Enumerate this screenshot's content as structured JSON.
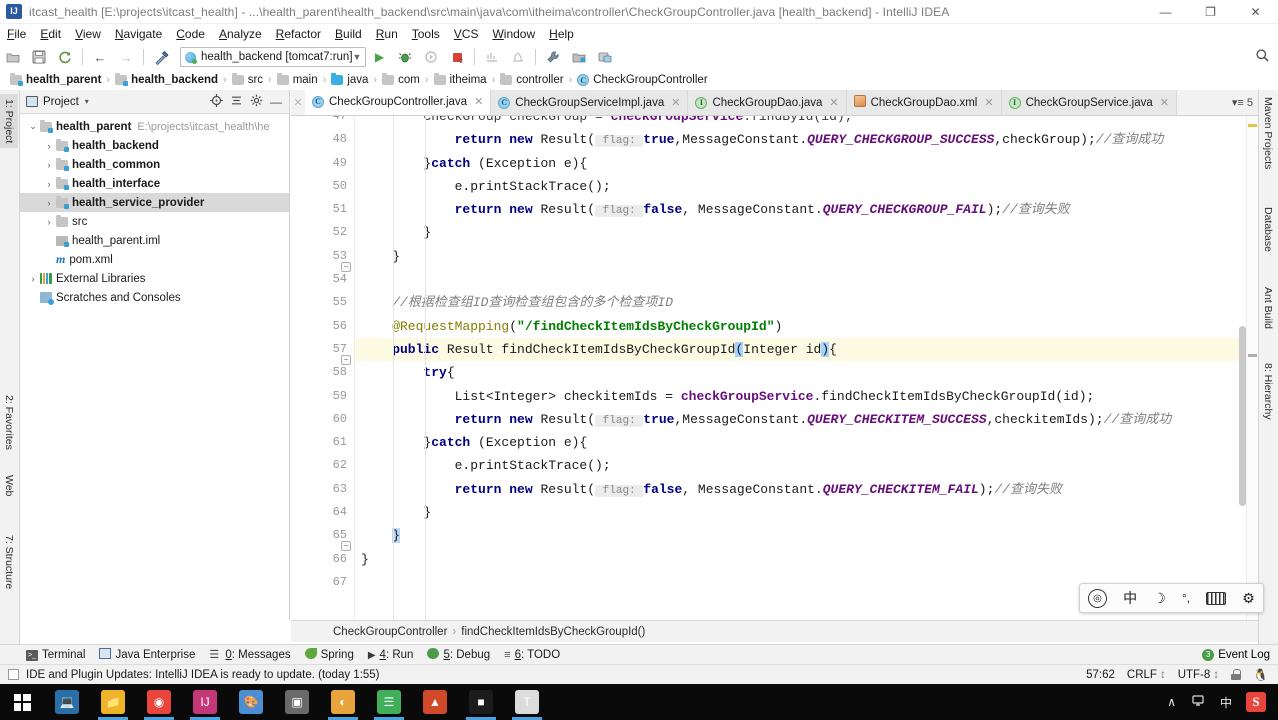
{
  "window": {
    "title": "itcast_health [E:\\projects\\itcast_health] - ...\\health_parent\\health_backend\\src\\main\\java\\com\\itheima\\controller\\CheckGroupController.java [health_backend] - IntelliJ IDEA",
    "minimize": "—",
    "maximize": "❐",
    "close": "✕"
  },
  "menu": [
    "File",
    "Edit",
    "View",
    "Navigate",
    "Code",
    "Analyze",
    "Refactor",
    "Build",
    "Run",
    "Tools",
    "VCS",
    "Window",
    "Help"
  ],
  "toolbar": {
    "open_icon": "open-folder-icon",
    "save_icon": "save-icon",
    "sync_icon": "sync-icon",
    "back_icon": "←",
    "forward_icon": "→",
    "build_icon": "hammer-icon",
    "run_config": "health_backend [tomcat7:run]",
    "run_icon": "▶",
    "debug_icon": "debug-icon",
    "rerun_icon": "rerun-icon",
    "stop_icon": "stop-icon",
    "coverage_icon": "coverage-icon",
    "profile_icon": "profile-icon",
    "settings_icon": "wrench-icon",
    "project_structure_icon": "project-structure-icon",
    "sdk_icon": "sdk-icon",
    "search_icon": "🔍"
  },
  "breadcrumb": [
    {
      "label": "health_parent",
      "icon": "module-folder-icon",
      "bold": true
    },
    {
      "label": "health_backend",
      "icon": "module-folder-icon",
      "bold": true
    },
    {
      "label": "src",
      "icon": "folder-icon",
      "bold": false
    },
    {
      "label": "main",
      "icon": "folder-icon",
      "bold": false
    },
    {
      "label": "java",
      "icon": "source-folder-icon",
      "bold": false
    },
    {
      "label": "com",
      "icon": "package-folder-icon",
      "bold": false
    },
    {
      "label": "itheima",
      "icon": "package-folder-icon",
      "bold": false
    },
    {
      "label": "controller",
      "icon": "package-folder-icon",
      "bold": false
    },
    {
      "label": "CheckGroupController",
      "icon": "class-icon",
      "bold": false
    }
  ],
  "left_tool_tabs": [
    {
      "label": "1: Project",
      "active": true
    },
    {
      "label": "2: Favorites",
      "active": false
    },
    {
      "label": "Web",
      "active": false
    },
    {
      "label": "7: Structure",
      "active": false
    }
  ],
  "right_tool_tabs": [
    {
      "label": "Maven Projects"
    },
    {
      "label": "Database"
    },
    {
      "label": "Ant Build"
    },
    {
      "label": "8: Hierarchy"
    }
  ],
  "project_panel": {
    "title": "Project",
    "caret": "▾",
    "actions": [
      "locate-icon",
      "collapse-all-icon",
      "gear-icon",
      "hide-icon"
    ],
    "tree": [
      {
        "depth": 0,
        "twisty": "⌄",
        "icon": "module-folder-icon",
        "label": "health_parent",
        "path": "E:\\projects\\itcast_health\\he",
        "bold": true,
        "selected": false
      },
      {
        "depth": 1,
        "twisty": "›",
        "icon": "module-folder-icon",
        "label": "health_backend",
        "path": "",
        "bold": true,
        "selected": false
      },
      {
        "depth": 1,
        "twisty": "›",
        "icon": "module-folder-icon",
        "label": "health_common",
        "path": "",
        "bold": true,
        "selected": false
      },
      {
        "depth": 1,
        "twisty": "›",
        "icon": "module-folder-icon",
        "label": "health_interface",
        "path": "",
        "bold": true,
        "selected": false
      },
      {
        "depth": 1,
        "twisty": "›",
        "icon": "module-folder-icon",
        "label": "health_service_provider",
        "path": "",
        "bold": true,
        "selected": true
      },
      {
        "depth": 1,
        "twisty": "›",
        "icon": "folder-icon",
        "label": "src",
        "path": "",
        "bold": false,
        "selected": false
      },
      {
        "depth": 1,
        "twisty": "",
        "icon": "iml-icon",
        "label": "health_parent.iml",
        "path": "",
        "bold": false,
        "selected": false
      },
      {
        "depth": 1,
        "twisty": "",
        "icon": "maven-icon",
        "label": "pom.xml",
        "path": "",
        "bold": false,
        "selected": false
      },
      {
        "depth": 0,
        "twisty": "›",
        "icon": "libraries-icon",
        "label": "External Libraries",
        "path": "",
        "bold": false,
        "selected": false
      },
      {
        "depth": 0,
        "twisty": "",
        "icon": "scratches-icon",
        "label": "Scratches and Consoles",
        "path": "",
        "bold": false,
        "selected": false
      }
    ]
  },
  "editor_tabs": [
    {
      "label": "CheckGroupController.java",
      "icon": "class-icon",
      "active": true
    },
    {
      "label": "CheckGroupServiceImpl.java",
      "icon": "class-icon",
      "active": false
    },
    {
      "label": "CheckGroupDao.java",
      "icon": "interface-icon",
      "active": false
    },
    {
      "label": "CheckGroupDao.xml",
      "icon": "xml-icon",
      "active": false
    },
    {
      "label": "CheckGroupService.java",
      "icon": "interface-icon",
      "active": false
    }
  ],
  "editor_tabs_overflow": "▾≡ 5",
  "code": {
    "first_line": 47,
    "lines": [
      {
        "num": 47,
        "partial": true,
        "highlight": false,
        "fold": "",
        "tokens": [
          {
            "t": "        CheckGroup checkGroup = ",
            "c": ""
          },
          {
            "t": "checkGroupService",
            "c": "svc"
          },
          {
            "t": ".findById(id);",
            "c": ""
          }
        ]
      },
      {
        "num": 48,
        "highlight": false,
        "fold": "",
        "tokens": [
          {
            "t": "            ",
            "c": ""
          },
          {
            "t": "return new ",
            "c": "k"
          },
          {
            "t": "Result(",
            "c": ""
          },
          {
            "t": " flag: ",
            "c": "hint"
          },
          {
            "t": "true",
            "c": "k"
          },
          {
            "t": ",MessageConstant.",
            "c": ""
          },
          {
            "t": "QUERY_CHECKGROUP_SUCCESS",
            "c": "fld"
          },
          {
            "t": ",checkGroup);",
            "c": ""
          },
          {
            "t": "//查询成功",
            "c": "cmt"
          }
        ]
      },
      {
        "num": 49,
        "highlight": false,
        "fold": "",
        "tokens": [
          {
            "t": "        }",
            "c": ""
          },
          {
            "t": "catch ",
            "c": "k"
          },
          {
            "t": "(Exception e){",
            "c": ""
          }
        ]
      },
      {
        "num": 50,
        "highlight": false,
        "fold": "",
        "tokens": [
          {
            "t": "            e.printStackTrace();",
            "c": ""
          }
        ]
      },
      {
        "num": 51,
        "highlight": false,
        "fold": "",
        "tokens": [
          {
            "t": "            ",
            "c": ""
          },
          {
            "t": "return new ",
            "c": "k"
          },
          {
            "t": "Result(",
            "c": ""
          },
          {
            "t": " flag: ",
            "c": "hint"
          },
          {
            "t": "false",
            "c": "k"
          },
          {
            "t": ", MessageConstant.",
            "c": ""
          },
          {
            "t": "QUERY_CHECKGROUP_FAIL",
            "c": "fld"
          },
          {
            "t": ");",
            "c": ""
          },
          {
            "t": "//查询失败",
            "c": "cmt"
          }
        ]
      },
      {
        "num": 52,
        "highlight": false,
        "fold": "",
        "tokens": [
          {
            "t": "        }",
            "c": ""
          }
        ]
      },
      {
        "num": 53,
        "highlight": false,
        "fold": "minus",
        "tokens": [
          {
            "t": "    }",
            "c": ""
          }
        ]
      },
      {
        "num": 54,
        "highlight": false,
        "fold": "",
        "tokens": [
          {
            "t": "",
            "c": ""
          }
        ]
      },
      {
        "num": 55,
        "highlight": false,
        "fold": "",
        "tokens": [
          {
            "t": "    //根据检查组ID查询检查组包含的多个检查项ID",
            "c": "cmt"
          }
        ]
      },
      {
        "num": 56,
        "highlight": false,
        "fold": "",
        "tokens": [
          {
            "t": "    @RequestMapping",
            "c": "ann"
          },
          {
            "t": "(",
            "c": ""
          },
          {
            "t": "\"/findCheckItemIdsByCheckGroupId\"",
            "c": "str"
          },
          {
            "t": ")",
            "c": ""
          }
        ]
      },
      {
        "num": 57,
        "highlight": true,
        "fold": "minus",
        "tokens": [
          {
            "t": "    public ",
            "c": "k"
          },
          {
            "t": "Result findCheckItemIdsByCheckGroupId",
            "c": ""
          },
          {
            "t": "(",
            "c": "sel"
          },
          {
            "t": "Integer id",
            "c": ""
          },
          {
            "t": ")",
            "c": "sel"
          },
          {
            "t": "{",
            "c": ""
          }
        ]
      },
      {
        "num": 58,
        "highlight": false,
        "fold": "",
        "tokens": [
          {
            "t": "        ",
            "c": ""
          },
          {
            "t": "try",
            "c": "k"
          },
          {
            "t": "{",
            "c": ""
          }
        ]
      },
      {
        "num": 59,
        "highlight": false,
        "fold": "",
        "tokens": [
          {
            "t": "            List<Integer> checkitemIds = ",
            "c": ""
          },
          {
            "t": "checkGroupService",
            "c": "svc"
          },
          {
            "t": ".findCheckItemIdsByCheckGroupId(id);",
            "c": ""
          }
        ]
      },
      {
        "num": 60,
        "highlight": false,
        "fold": "",
        "tokens": [
          {
            "t": "            ",
            "c": ""
          },
          {
            "t": "return new ",
            "c": "k"
          },
          {
            "t": "Result(",
            "c": ""
          },
          {
            "t": " flag: ",
            "c": "hint"
          },
          {
            "t": "true",
            "c": "k"
          },
          {
            "t": ",MessageConstant.",
            "c": ""
          },
          {
            "t": "QUERY_CHECKITEM_SUCCESS",
            "c": "fld"
          },
          {
            "t": ",checkitemIds);",
            "c": ""
          },
          {
            "t": "//查询成功",
            "c": "cmt"
          }
        ]
      },
      {
        "num": 61,
        "highlight": false,
        "fold": "",
        "tokens": [
          {
            "t": "        }",
            "c": ""
          },
          {
            "t": "catch ",
            "c": "k"
          },
          {
            "t": "(Exception e){",
            "c": ""
          }
        ]
      },
      {
        "num": 62,
        "highlight": false,
        "fold": "",
        "tokens": [
          {
            "t": "            e.printStackTrace();",
            "c": ""
          }
        ]
      },
      {
        "num": 63,
        "highlight": false,
        "fold": "",
        "tokens": [
          {
            "t": "            ",
            "c": ""
          },
          {
            "t": "return new ",
            "c": "k"
          },
          {
            "t": "Result(",
            "c": ""
          },
          {
            "t": " flag: ",
            "c": "hint"
          },
          {
            "t": "false",
            "c": "k"
          },
          {
            "t": ", MessageConstant.",
            "c": ""
          },
          {
            "t": "QUERY_CHECKITEM_FAIL",
            "c": "fld"
          },
          {
            "t": ");",
            "c": ""
          },
          {
            "t": "//查询失败",
            "c": "cmt"
          }
        ]
      },
      {
        "num": 64,
        "highlight": false,
        "fold": "",
        "tokens": [
          {
            "t": "        }",
            "c": ""
          }
        ]
      },
      {
        "num": 65,
        "highlight": false,
        "fold": "minus",
        "tokens": [
          {
            "t": "    ",
            "c": ""
          },
          {
            "t": "}",
            "c": "caret-brace"
          }
        ]
      },
      {
        "num": 66,
        "highlight": false,
        "fold": "",
        "tokens": [
          {
            "t": "}",
            "c": ""
          }
        ]
      },
      {
        "num": 67,
        "highlight": false,
        "fold": "",
        "tokens": [
          {
            "t": "",
            "c": ""
          }
        ]
      }
    ]
  },
  "code_breadcrumb": [
    "CheckGroupController",
    "findCheckItemIdsByCheckGroupId()"
  ],
  "ime": {
    "logo": "sogou-logo-icon",
    "mode": "中",
    "moon": "☽",
    "punct": "°,",
    "keyboard": "keyboard-icon",
    "settings": "⚙"
  },
  "bottom_tabs": [
    {
      "label": "Terminal",
      "num": "",
      "icon": "terminal-icon"
    },
    {
      "label": "Java Enterprise",
      "num": "",
      "icon": "java-ee-icon"
    },
    {
      "label": "0: Messages",
      "num": "0",
      "icon": "messages-icon"
    },
    {
      "label": "Spring",
      "num": "",
      "icon": "spring-icon"
    },
    {
      "label": "4: Run",
      "num": "4",
      "icon": "run-icon"
    },
    {
      "label": "5: Debug",
      "num": "5",
      "icon": "debug-icon"
    },
    {
      "label": "6: TODO",
      "num": "6",
      "icon": "todo-icon"
    }
  ],
  "event_log": {
    "label": "Event Log",
    "badge": "3"
  },
  "status": {
    "message": "IDE and Plugin Updates: IntelliJ IDEA is ready to update. (today 1:55)",
    "caret_position": "57:62",
    "line_separator": "CRLF",
    "encoding": "UTF-8",
    "separator_caret": "↕",
    "lock_icon": "unlock-icon",
    "tux_icon": "tux-icon"
  },
  "taskbar": {
    "start": "windows-start-icon",
    "apps": [
      {
        "name": "task-view-icon",
        "glyph": "💻",
        "bg": "#2b6fa8",
        "running": false
      },
      {
        "name": "file-explorer-icon",
        "glyph": "📁",
        "bg": "#f0b429",
        "running": true
      },
      {
        "name": "chrome-icon",
        "glyph": "◉",
        "bg": "#e8453c",
        "running": true
      },
      {
        "name": "intellij-idea-icon",
        "glyph": "IJ",
        "bg": "#c4387a",
        "running": true
      },
      {
        "name": "paint-icon",
        "glyph": "🎨",
        "bg": "#4a8fd4",
        "running": false
      },
      {
        "name": "virtualbox-icon",
        "glyph": "▣",
        "bg": "#6a6a6a",
        "running": false
      },
      {
        "name": "navicat-icon",
        "glyph": "◐",
        "bg": "#e8a33d",
        "running": true
      },
      {
        "name": "notepad-icon",
        "glyph": "☰",
        "bg": "#3faf5a",
        "running": true
      },
      {
        "name": "xmind-icon",
        "glyph": "▲",
        "bg": "#d04a2a",
        "running": false
      },
      {
        "name": "console-icon",
        "glyph": "■",
        "bg": "#1c1c1c",
        "running": true
      },
      {
        "name": "typora-icon",
        "glyph": "T",
        "bg": "#dcdcdc",
        "running": true
      }
    ],
    "tray": {
      "chevron": "∧",
      "network": "network-icon",
      "ime": "中",
      "sogou": "S"
    }
  }
}
